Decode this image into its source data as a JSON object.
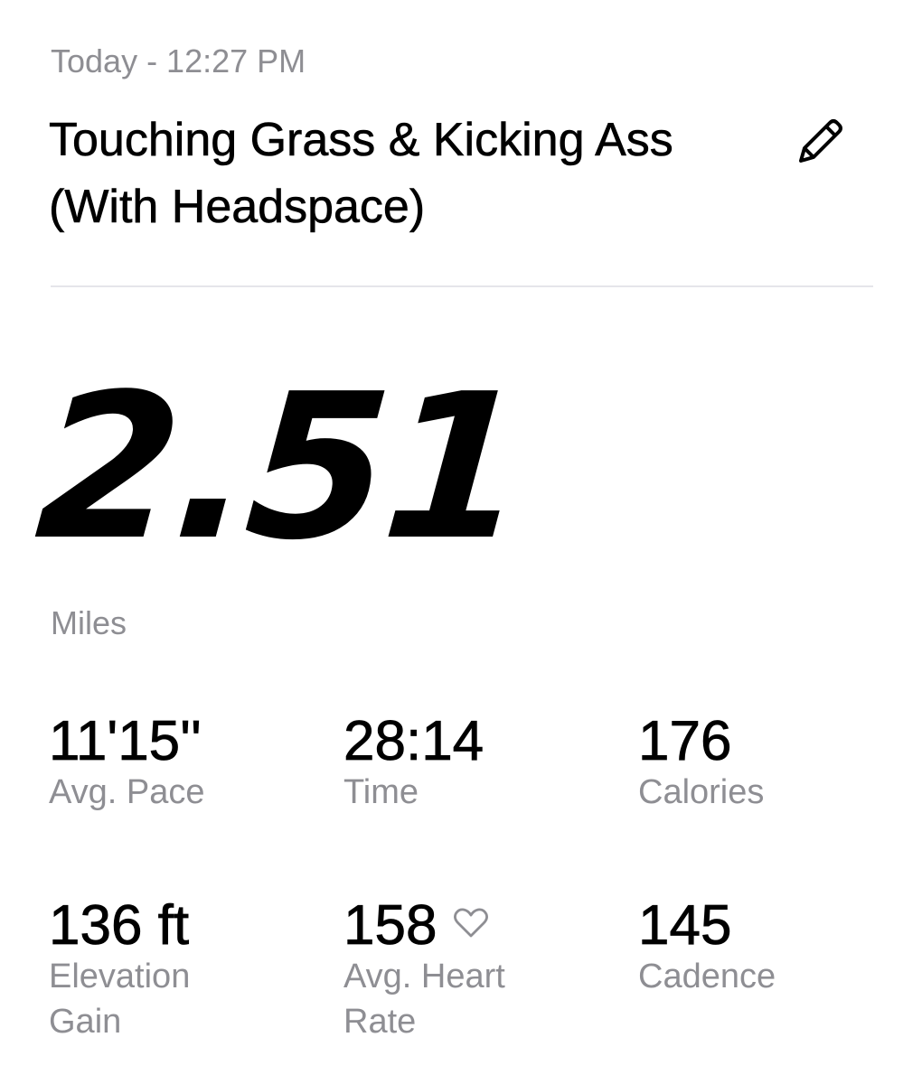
{
  "activity": {
    "timestamp": "Today - 12:27 PM",
    "title": "Touching Grass & Kicking Ass (With Headspace)",
    "edit_icon": "pencil-icon"
  },
  "summary": {
    "distance_value": "2.51",
    "distance_unit": "Miles"
  },
  "stats": {
    "avg_pace": {
      "value": "11'15''",
      "label": "Avg. Pace"
    },
    "time": {
      "value": "28:14",
      "label": "Time"
    },
    "calories": {
      "value": "176",
      "label": "Calories"
    },
    "elevation": {
      "value": "136 ft",
      "label": "Elevation Gain"
    },
    "heart_rate": {
      "value": "158",
      "label": "Avg. Heart Rate",
      "icon": "heart-outline-icon"
    },
    "cadence": {
      "value": "145",
      "label": "Cadence"
    }
  },
  "colors": {
    "primary_text": "#000000",
    "secondary_text": "#8e8e93",
    "divider": "#e5e5ea",
    "background": "#ffffff"
  }
}
